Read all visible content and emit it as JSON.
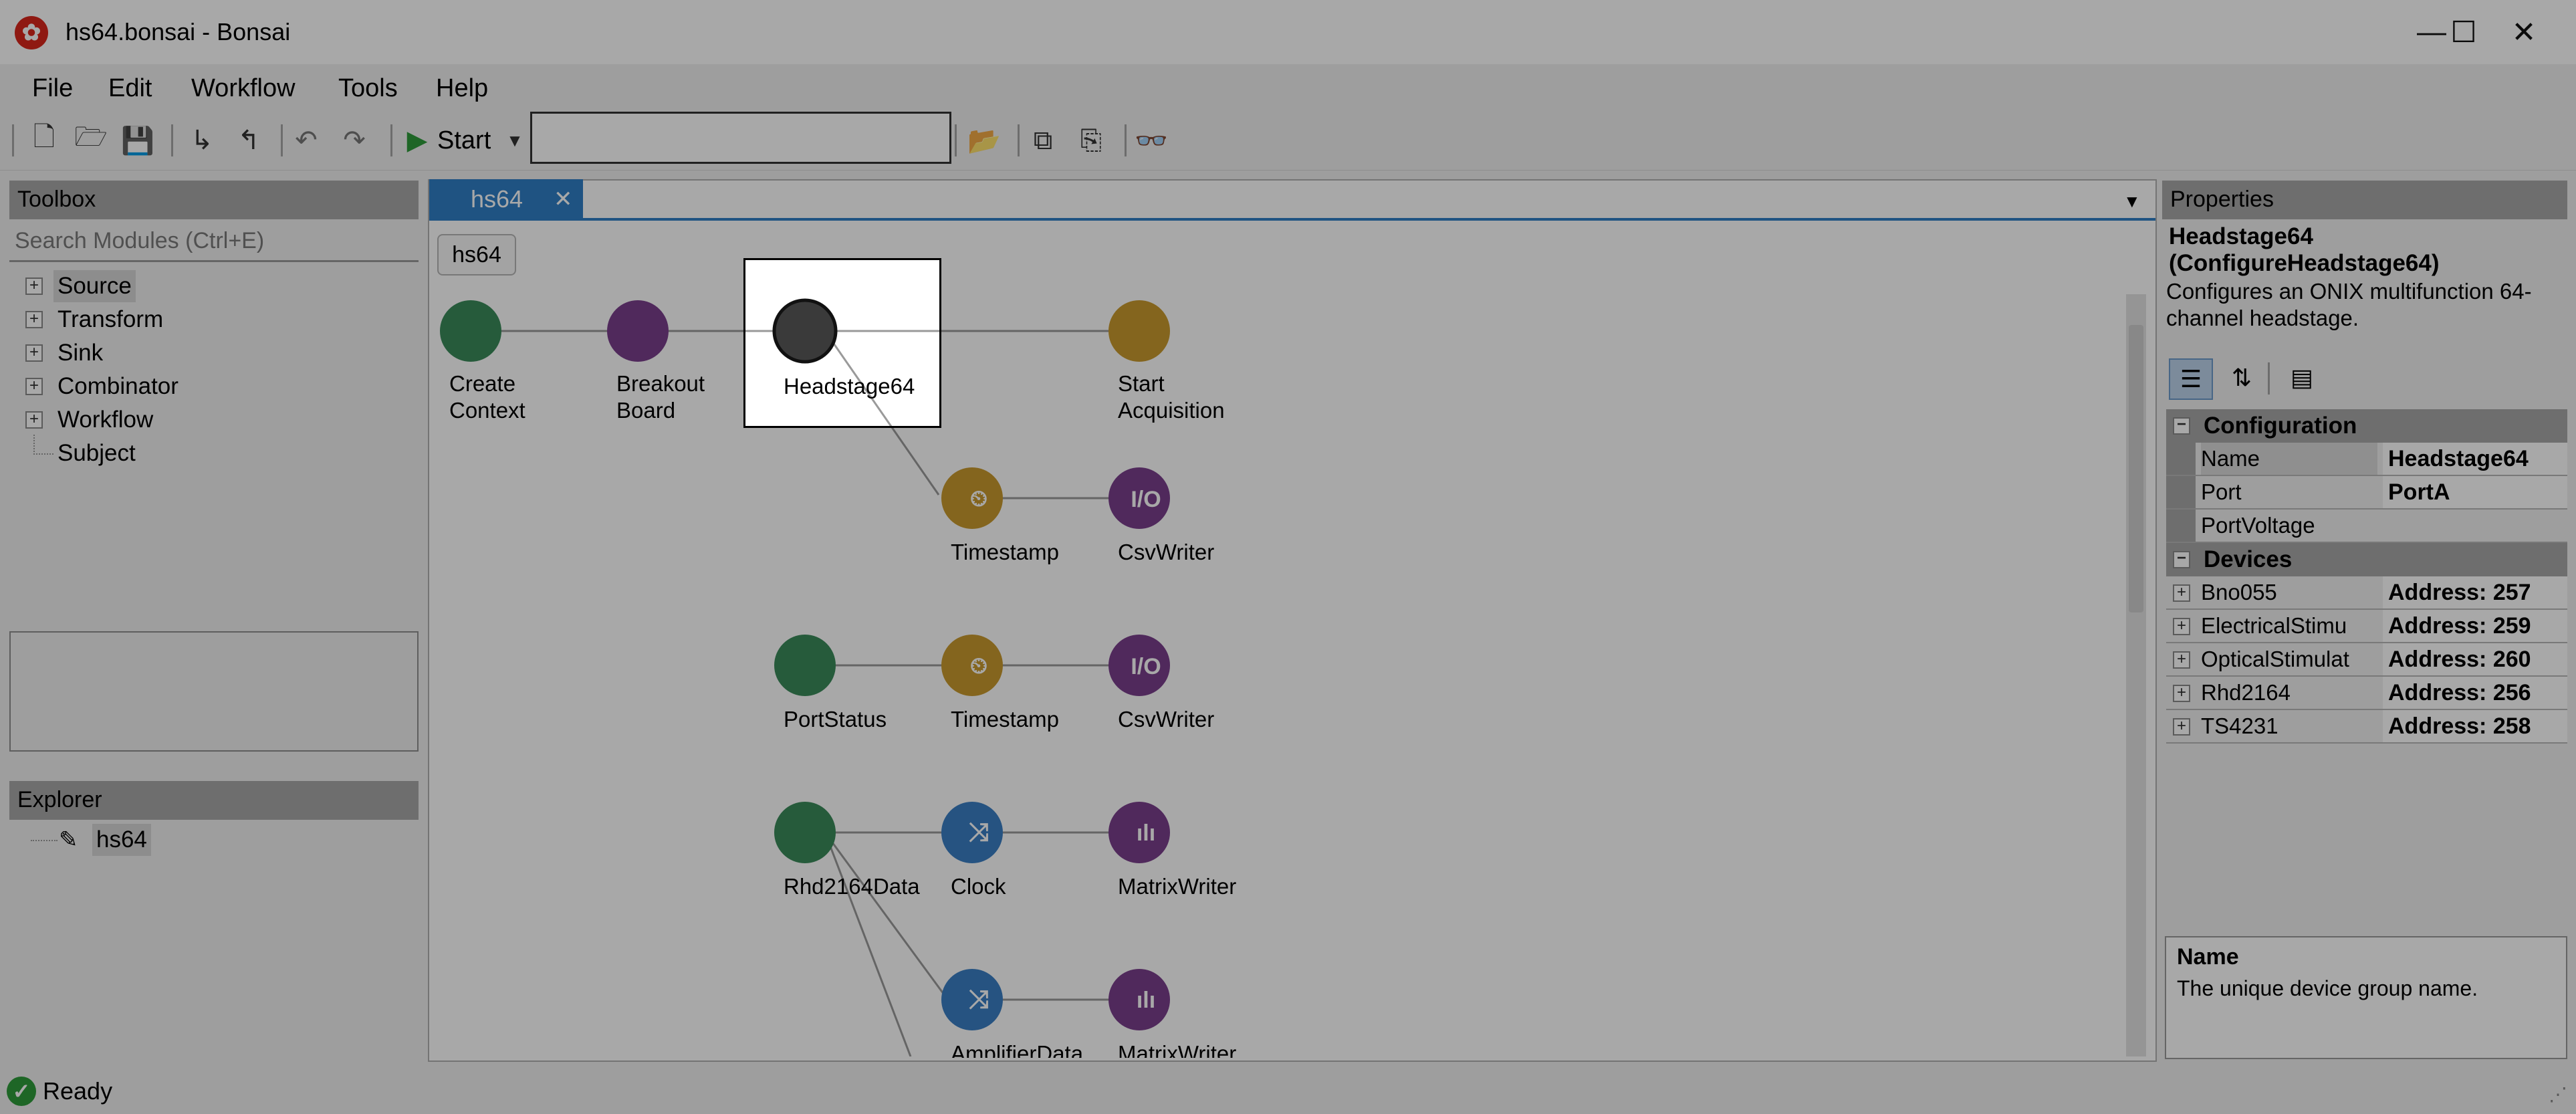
{
  "window": {
    "title": "hs64.bonsai - Bonsai",
    "minimize_glyph": "—",
    "maximize_glyph": "☐",
    "close_glyph": "✕"
  },
  "menu": [
    "File",
    "Edit",
    "Workflow",
    "Tools",
    "Help"
  ],
  "toolbar": {
    "start_label": "Start",
    "workflow_input_value": ""
  },
  "toolbox": {
    "title": "Toolbox",
    "search_placeholder": "Search Modules (Ctrl+E)",
    "items": [
      "Source",
      "Transform",
      "Sink",
      "Combinator",
      "Workflow",
      "Subject"
    ]
  },
  "explorer": {
    "title": "Explorer",
    "item": "hs64"
  },
  "editor": {
    "tab_label": "hs64",
    "tab_close": "✕",
    "breadcrumb": "hs64",
    "nodes": [
      {
        "label1": "Create",
        "label2": "Context",
        "color": "#3a8a5a"
      },
      {
        "label1": "Breakout",
        "label2": "Board",
        "color": "#7a3f8c"
      },
      {
        "label1": "Headstage64",
        "label2": "",
        "color": "#3a3a3a"
      },
      {
        "label1": "Start",
        "label2": "Acquisition",
        "color": "#c99a2e"
      },
      {
        "label1": "Timestamp",
        "label2": "",
        "color": "#c99a2e"
      },
      {
        "label1": "CsvWriter",
        "label2": "",
        "color": "#7a3f8c"
      },
      {
        "label1": "PortStatus",
        "label2": "",
        "color": "#3a8a5a"
      },
      {
        "label1": "Timestamp",
        "label2": "",
        "color": "#c99a2e"
      },
      {
        "label1": "CsvWriter",
        "label2": "",
        "color": "#7a3f8c"
      },
      {
        "label1": "Rhd2164Data",
        "label2": "",
        "color": "#3a8a5a"
      },
      {
        "label1": "Clock",
        "label2": "",
        "color": "#3b7fc4"
      },
      {
        "label1": "MatrixWriter",
        "label2": "",
        "color": "#7a3f8c"
      },
      {
        "label1": "AmplifierData",
        "label2": "",
        "color": "#3b7fc4"
      },
      {
        "label1": "MatrixWriter",
        "label2": "",
        "color": "#7a3f8c"
      }
    ],
    "io_glyph": "I/O"
  },
  "properties": {
    "title": "Properties",
    "selected_name": "Headstage64",
    "selected_type": "(ConfigureHeadstage64)",
    "selected_desc": "Configures an ONIX multifunction 64-channel headstage.",
    "categories": [
      {
        "name": "Configuration",
        "rows": [
          {
            "name": "Name",
            "value": "Headstage64",
            "expandable": false
          },
          {
            "name": "Port",
            "value": "PortA",
            "expandable": false
          },
          {
            "name": "PortVoltage",
            "value": "",
            "expandable": false
          }
        ]
      },
      {
        "name": "Devices",
        "rows": [
          {
            "name": "Bno055",
            "value": "Address: 257",
            "expandable": true
          },
          {
            "name": "ElectricalStimu",
            "value": "Address: 259",
            "expandable": true
          },
          {
            "name": "OpticalStimulat",
            "value": "Address: 260",
            "expandable": true
          },
          {
            "name": "Rhd2164",
            "value": "Address: 256",
            "expandable": true
          },
          {
            "name": "TS4231",
            "value": "Address: 258",
            "expandable": true
          }
        ]
      }
    ],
    "help_title": "Name",
    "help_text": "The unique device group name."
  },
  "status": {
    "text": "Ready"
  },
  "colors": {
    "accent": "#2f7fc5",
    "header_gray": "#a8a8a8",
    "ready_green": "#2e9b3a"
  }
}
